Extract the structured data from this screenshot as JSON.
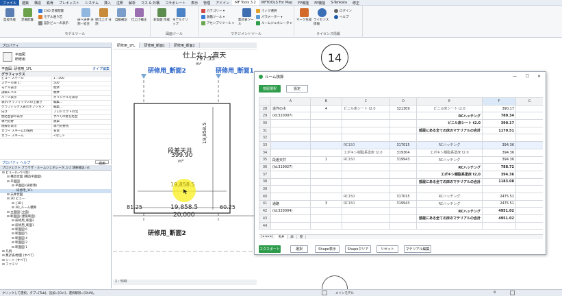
{
  "ribbon_tabs": [
    "ファイル",
    "建築",
    "構造",
    "鉄骨",
    "プレキャスト",
    "システム",
    "挿入",
    "注釈",
    "解析",
    "マス & 外構",
    "コラボレート",
    "表示",
    "管理",
    "アドイン",
    "MF Tools 3.2",
    "MFTOOLS For Map",
    "FP機能",
    "FP機能",
    "S-Tenkata",
    "修正"
  ],
  "ribbon": {
    "btn1": "型枠作成",
    "btn2": "足場配置",
    "small1": "CAD 足場配置",
    "small2": "モデル通り芯",
    "small3": "設計ビューの表示",
    "btn3": "床へ天井\n分割・結合",
    "btn4": "梁仕上げ\n分割",
    "btn5": "自動補正",
    "btn6": "仕上げ補正",
    "btn7": "非仮面\n作成",
    "btn8": "モデルクリップ",
    "small4": "カテゴリー ▾",
    "small5": "鉄筋ツール ▾",
    "small6": "アセンブリツール ▾",
    "btn9": "集計表ツール",
    "small7": "ウィグ選択",
    "small8": "パラメーター ▾",
    "small9": "ルームジェネレータ ▾",
    "btn10": "マーク生成",
    "btn11": "ライセンス情報",
    "small10": "ログイン",
    "small11": "ヘルプ",
    "group1": "モデルツール",
    "group2": "図面ツール",
    "group3": "マネジメントツール",
    "group4": "ライセンス情報"
  },
  "properties": {
    "title": "プロパティ",
    "type_line1": "平面図",
    "type_line2": "研修用",
    "selector": "平面図: 研修用_1FL",
    "edit_type": "タイプ編集",
    "section": "グラフィックス",
    "rows": [
      {
        "k": "ビュー スケール",
        "v": "1 : 500"
      },
      {
        "k": "スケール値 1:",
        "v": "500"
      },
      {
        "k": "モデル表示",
        "v": "標準"
      },
      {
        "k": "詳細レベル",
        "v": "標準"
      },
      {
        "k": "パーツ表示",
        "v": "オリジナルを表示"
      },
      {
        "k": "表示/グラフィックスの上書き",
        "v": "編集..."
      },
      {
        "k": "グラフィックス表示オプション",
        "v": "編集..."
      },
      {
        "k": "向き",
        "v": "プロジェクトの北"
      },
      {
        "k": "壁結合部の表示",
        "v": "すべての壁を結合"
      },
      {
        "k": "専門分野",
        "v": "建築"
      },
      {
        "k": "隠線を表示",
        "v": "専門分野別"
      },
      {
        "k": "カラー スキームの場所",
        "v": "背景"
      },
      {
        "k": "カラー スキーム",
        "v": "<なし>"
      }
    ],
    "help": "プロパティ ヘルプ",
    "apply": "適用"
  },
  "browser": {
    "title": "プロジェクト ブラウザ - ルームジェネレータ_1-2 球車検証.rvt",
    "nodes": [
      "ビュー(レベル別)",
      "構造伏図 (構造平面図)",
      "平面図",
      "平面図 (研修用)",
      "研修用_1FL",
      "天井伏図",
      "3D ビュー",
      "{3D}",
      "3D_ルーム積算",
      "立面図 (立面)",
      "断面図 (建築断面)",
      "研修用_断面2",
      "研修用_断面1",
      "断面図 6",
      "断面図 5",
      "断面図 4",
      "断面図 2",
      "断面図 1",
      "凡例",
      "集計表/数量 (すべて)",
      "シート (すべて)",
      "ファミリ"
    ]
  },
  "view_tabs": [
    "研修用_1FL",
    "研修用_断面1",
    "研修用_断面2"
  ],
  "drawing": {
    "top_label": "仕上なし:直天",
    "top_area": "797.35",
    "section_left": "研修用_断面2",
    "section_right": "研修用_断面1",
    "room_name": "段差天井",
    "room_area": "399.90",
    "unit": "m²",
    "dim_v": "19,858.5",
    "dim_h_yellow": "19,858.5",
    "dim_h": "19,858.5",
    "dim_h2": "20,000",
    "dim_left": "81.25",
    "dim_right": "60.25",
    "section_bottom": "研修用_断面2",
    "grid_bubble": "14"
  },
  "view_scale": "1 : 500",
  "dialog": {
    "title": "ルーム積算",
    "btn_select": "部屋選択",
    "btn_setting": "設定",
    "columns": [
      "A",
      "B",
      "C",
      "D",
      "E",
      "F",
      "G"
    ],
    "rows": [
      {
        "n": "28",
        "a": "造作の木",
        "b": "4",
        "c": "ビニル床シート t2.0",
        "d": "321309",
        "e": "ビニル床シート t2.0",
        "f": "390.17",
        "type": "item"
      },
      {
        "n": "29",
        "a": "(Id:320007)",
        "b": "",
        "c": "",
        "d": "",
        "e": "RCハッチング",
        "f": "780.34",
        "type": "sub"
      },
      {
        "n": "30",
        "a": "",
        "b": "",
        "c": "",
        "d": "",
        "e": "ビニル床シート t2.0",
        "f": "390.17",
        "type": "sub"
      },
      {
        "n": "31",
        "a": "",
        "b": "",
        "c": "",
        "d": "",
        "e": "部屋にある全ての床のマテリアルの合計",
        "f": "1170.51",
        "type": "tot"
      },
      {
        "n": "32",
        "a": "",
        "b": "",
        "c": "",
        "d": "",
        "e": "",
        "f": "",
        "type": "blank"
      },
      {
        "n": "33",
        "a": "",
        "b": "",
        "c": "RC150",
        "d": "317015",
        "e": "RCハッチング",
        "f": "394.36",
        "type": "item"
      },
      {
        "n": "34",
        "a": "",
        "b": "",
        "c": "エポキシ樹脂系塗床 t2.0",
        "d": "319304",
        "e": "エポキシ樹脂系塗床 t2.0",
        "f": "394.36",
        "type": "item"
      },
      {
        "n": "35",
        "a": "段差天井",
        "b": "1",
        "c": "RC150",
        "d": "319943",
        "e": "RCハッチング",
        "f": "394.36",
        "type": "item"
      },
      {
        "n": "36",
        "a": "(Id:319927)",
        "b": "",
        "c": "",
        "d": "",
        "e": "RCハッチング",
        "f": "788.72",
        "type": "sub"
      },
      {
        "n": "37",
        "a": "",
        "b": "",
        "c": "",
        "d": "",
        "e": "エポキシ樹脂系塗床 t2.0",
        "f": "394.36",
        "type": "sub"
      },
      {
        "n": "38",
        "a": "",
        "b": "",
        "c": "",
        "d": "",
        "e": "部屋にある全ての床のマテリアルの合計",
        "f": "1183.08",
        "type": "tot"
      },
      {
        "n": "39",
        "a": "",
        "b": "",
        "c": "",
        "d": "",
        "e": "",
        "f": "",
        "type": "blank"
      },
      {
        "n": "40",
        "a": "",
        "b": "",
        "c": "RC150",
        "d": "317015",
        "e": "RCハッチング",
        "f": "2475.51",
        "type": "item"
      },
      {
        "n": "41",
        "a": "通路",
        "b": "3",
        "c": "RC150",
        "d": "319943",
        "e": "RCハッチング",
        "f": "2475.51",
        "type": "item"
      },
      {
        "n": "42",
        "a": "(Id:320004)",
        "b": "",
        "c": "",
        "d": "",
        "e": "RCハッチング",
        "f": "4951.02",
        "type": "sub"
      },
      {
        "n": "43",
        "a": "",
        "b": "",
        "c": "",
        "d": "",
        "e": "部屋にある全ての床のマテリアルの合計",
        "f": "4951.02",
        "type": "tot"
      },
      {
        "n": "44",
        "a": "",
        "b": "",
        "c": "",
        "d": "",
        "e": "",
        "f": "",
        "type": "blank"
      }
    ],
    "sheet_tabs": [
      "天井",
      "床",
      "壁"
    ],
    "btn_export": "エクスポート",
    "btn_choose": "選択",
    "btn_shape": "Shape表示",
    "btn_shapeclear": "Shapeクリア",
    "btn_reset": "リセット",
    "btn_material": "マテリアル編集"
  },
  "status": {
    "left": "クリックして選択。タブ=[Tab]、追加=[Ctrl]、選択解除=[Shift]。",
    "model": "メインモデル",
    "coord": ":0"
  }
}
